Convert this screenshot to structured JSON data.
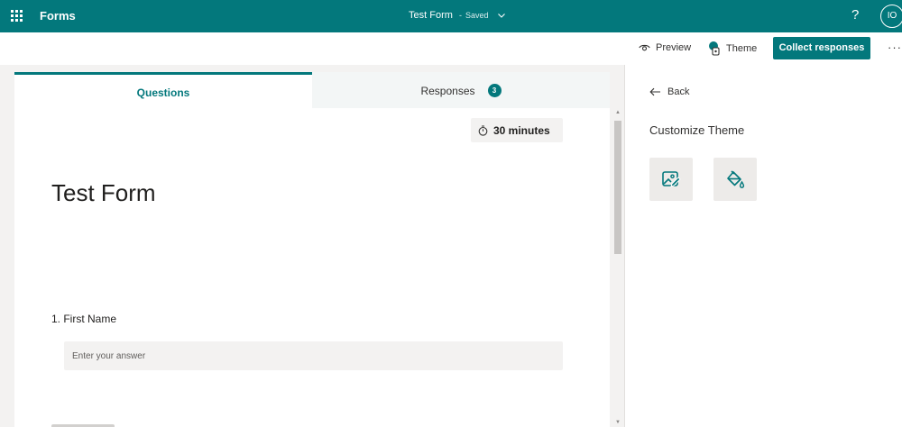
{
  "header": {
    "app_name": "Forms",
    "form_title": "Test Form",
    "save_status": "Saved",
    "help_label": "?",
    "avatar_initials": "IO"
  },
  "toolbar": {
    "preview_label": "Preview",
    "theme_label": "Theme",
    "collect_label": "Collect responses",
    "more_label": "···"
  },
  "tabs": {
    "questions_label": "Questions",
    "responses_label": "Responses",
    "responses_count": "3"
  },
  "form": {
    "timer_label": "30 minutes",
    "title": "Test Form",
    "questions": [
      {
        "label": "1. First Name",
        "placeholder": "Enter your answer"
      }
    ]
  },
  "panel": {
    "back_label": "Back",
    "title": "Customize Theme",
    "tiles": [
      "image-icon",
      "paint-bucket-icon"
    ]
  },
  "colors": {
    "accent": "#03787c",
    "surface": "#ffffff",
    "background": "#f3f2f1",
    "tile": "#edebe9"
  }
}
